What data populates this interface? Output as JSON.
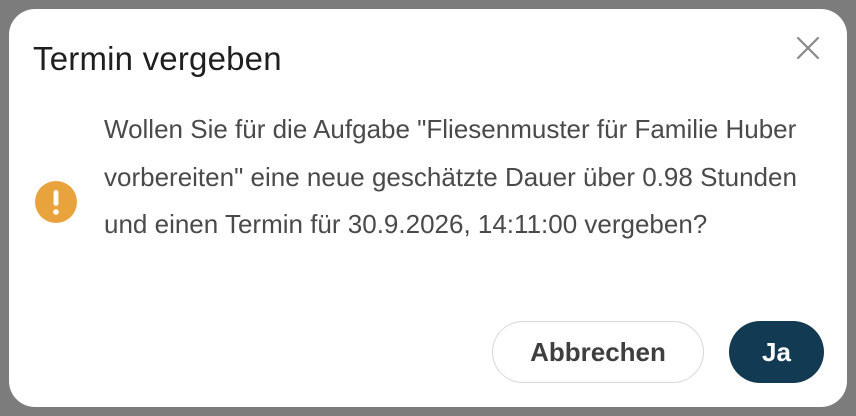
{
  "dialog": {
    "title": "Termin vergeben",
    "message": "Wollen Sie für die Aufgabe \"Fliesenmuster für Familie Huber vorbereiten\" eine neue geschätzte Dauer über 0.98 Stunden und einen Termin für 30.9.2026, 14:11:00 vergeben?",
    "cancel_label": "Abbrechen",
    "confirm_label": "Ja",
    "close_icon": "close-icon",
    "status_icon": "exclamation-circle-icon"
  },
  "colors": {
    "warning": "#e8a33d",
    "primary_button": "#123a52",
    "title_text": "#1f1f1f",
    "body_text": "#4a4a4a",
    "overlay": "#7c7c7c"
  }
}
